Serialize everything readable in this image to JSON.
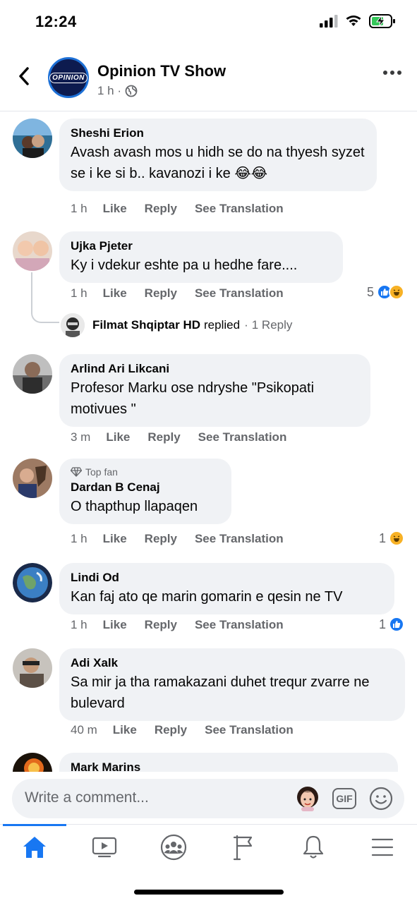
{
  "status": {
    "time": "12:24"
  },
  "header": {
    "page_name": "Opinion TV Show",
    "meta": "1 h ·",
    "avatar_text": "OPINION"
  },
  "comments": [
    {
      "author": "Sheshi Erion",
      "top_fan": "",
      "text": "Avash avash mos u hidh se do na thyesh syzet se i ke si b.. kavanozi i ke 😂😂",
      "time": "1 h",
      "reactions": ""
    },
    {
      "author": "Ujka Pjeter",
      "top_fan": "",
      "text": "Ky i vdekur eshte pa u hedhe fare....",
      "time": "1 h",
      "reactions": "5"
    },
    {
      "author": "Arlind Ari Likcani",
      "top_fan": "",
      "text": "Profesor Marku ose ndryshe  \"Psikopati motivues \"",
      "time": "3 m",
      "reactions": ""
    },
    {
      "author": "Dardan B Cenaj",
      "top_fan": "Top fan",
      "text": "O thapthup llapaqen",
      "time": "1 h",
      "reactions": "1"
    },
    {
      "author": "Lindi Od",
      "top_fan": "",
      "text": "Kan faj ato qe marin gomarin e qesin ne TV",
      "time": "1 h",
      "reactions": "1"
    },
    {
      "author": "Adi Xalk",
      "top_fan": "",
      "text": "Sa mir ja tha ramakazani duhet trequr zvarre ne bulevard",
      "time": "40 m",
      "reactions": ""
    },
    {
      "author": "Mark Marins",
      "top_fan": "",
      "text": "",
      "time": "",
      "reactions": ""
    }
  ],
  "actions": {
    "like": "Like",
    "reply": "Reply",
    "translate": "See Translation"
  },
  "reply_thread": {
    "name": "Filmat Shqiptar HD",
    "replied": "replied",
    "sep": "·",
    "count": "1 Reply"
  },
  "composer": {
    "placeholder": "Write a comment..."
  },
  "colors": {
    "accent": "#1877f2",
    "bubble": "#f0f2f5",
    "secondary_text": "#65676b"
  }
}
